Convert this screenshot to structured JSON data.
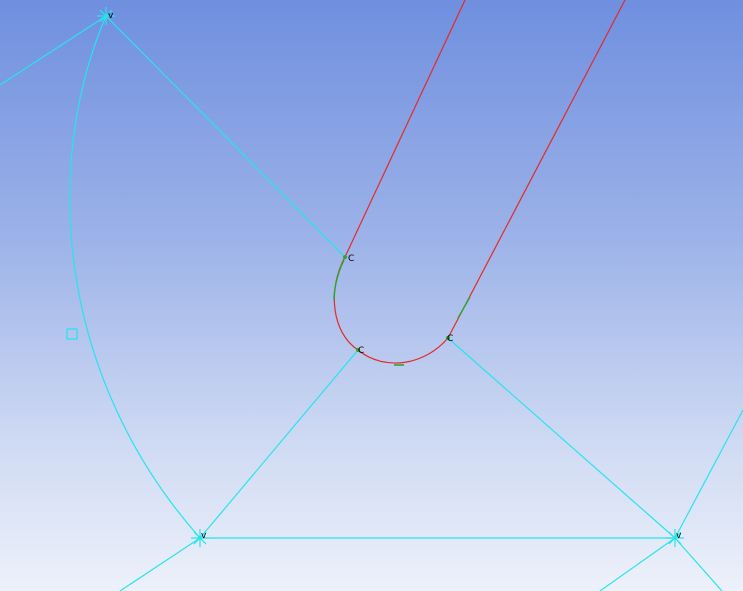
{
  "viewport": {
    "gradient_top": "#6f8fdf",
    "gradient_bottom": "#edf1fa"
  },
  "colors": {
    "construction_line": "#26e4ee",
    "edge_red": "#e42a2a",
    "edge_green": "#2fa52f",
    "marker_outline": "#000000"
  },
  "vertex_labels": {
    "top_left": "v",
    "bottom_left": "v",
    "bottom_right": "v"
  },
  "curve_point_labels": {
    "arc_top": "C",
    "arc_bottom": "C",
    "arc_right": "C"
  },
  "icons": {
    "vertex_marker": "star-vertex-icon",
    "midpoint_marker": "square-handle-icon"
  }
}
